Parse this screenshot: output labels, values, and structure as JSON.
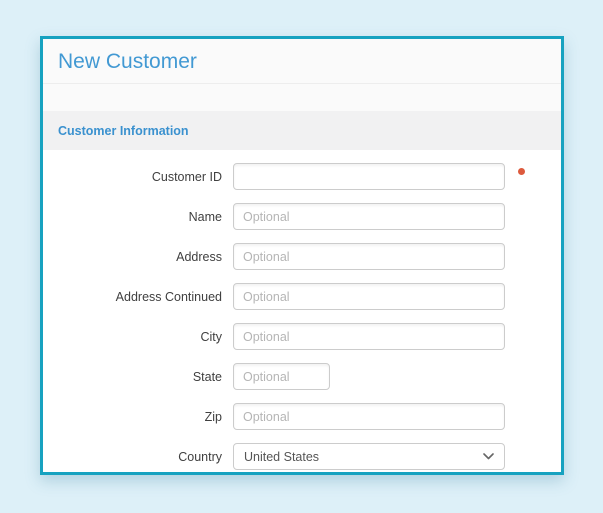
{
  "window": {
    "title": "New Customer",
    "section_title": "Customer Information"
  },
  "form": {
    "fields": [
      {
        "name": "customer-id",
        "label": "Customer ID",
        "value": "",
        "placeholder": "",
        "required": true,
        "control": "input",
        "width": "full"
      },
      {
        "name": "name",
        "label": "Name",
        "value": "",
        "placeholder": "Optional",
        "required": false,
        "control": "input",
        "width": "full"
      },
      {
        "name": "address",
        "label": "Address",
        "value": "",
        "placeholder": "Optional",
        "required": false,
        "control": "input",
        "width": "full"
      },
      {
        "name": "address-continued",
        "label": "Address Continued",
        "value": "",
        "placeholder": "Optional",
        "required": false,
        "control": "input",
        "width": "full"
      },
      {
        "name": "city",
        "label": "City",
        "value": "",
        "placeholder": "Optional",
        "required": false,
        "control": "input",
        "width": "full"
      },
      {
        "name": "state",
        "label": "State",
        "value": "",
        "placeholder": "Optional",
        "required": false,
        "control": "input",
        "width": "short"
      },
      {
        "name": "zip",
        "label": "Zip",
        "value": "",
        "placeholder": "Optional",
        "required": false,
        "control": "input",
        "width": "full"
      },
      {
        "name": "country",
        "label": "Country",
        "value": "United States",
        "placeholder": "",
        "required": false,
        "control": "select",
        "width": "full"
      }
    ]
  },
  "icons": {
    "country_dropdown": "chevron-down-icon",
    "required_indicator": "required-dot"
  },
  "colors": {
    "page_background": "#ddf0f8",
    "dialog_border": "#17a2c0",
    "title_text": "#4299d3",
    "section_background": "#f1f1f2",
    "section_text": "#3a91cf",
    "required_dot": "#dd5a3d",
    "input_border": "#cccccc",
    "placeholder_text": "#b5b5b5"
  }
}
